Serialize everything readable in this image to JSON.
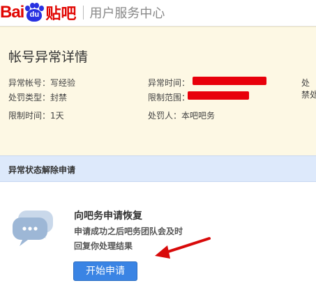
{
  "header": {
    "logo_bai": "Bai",
    "logo_du": "du",
    "logo_tieba": "贴吧",
    "subtitle": "用户服务中心"
  },
  "detail": {
    "title": "帐号异常详情",
    "fields": {
      "account_label": "异常帐号：",
      "account_value": "写经验",
      "time_label": "异常时间：",
      "right_label_1": "处",
      "right_label_2": "禁处",
      "type_label": "处罚类型：",
      "type_value": "封禁",
      "scope_label": "限制范围：",
      "duration_label": "限制时间：",
      "duration_value": "1天",
      "punisher_label": "处罚人：",
      "punisher_value": "本吧吧务"
    }
  },
  "section": {
    "title": "异常状态解除申请"
  },
  "appeal": {
    "title": "向吧务申请恢复",
    "desc_line1": "申请成功之后吧务团队会及时",
    "desc_line2": "回复你处理结果",
    "button_label": "开始申请"
  },
  "colors": {
    "brand_red": "#e10602",
    "brand_blue": "#2932e1",
    "detail_bg": "#fdf8e4",
    "section_bg": "#dde9fb",
    "button_blue": "#3a84e4",
    "redaction_red": "#e8000b"
  }
}
